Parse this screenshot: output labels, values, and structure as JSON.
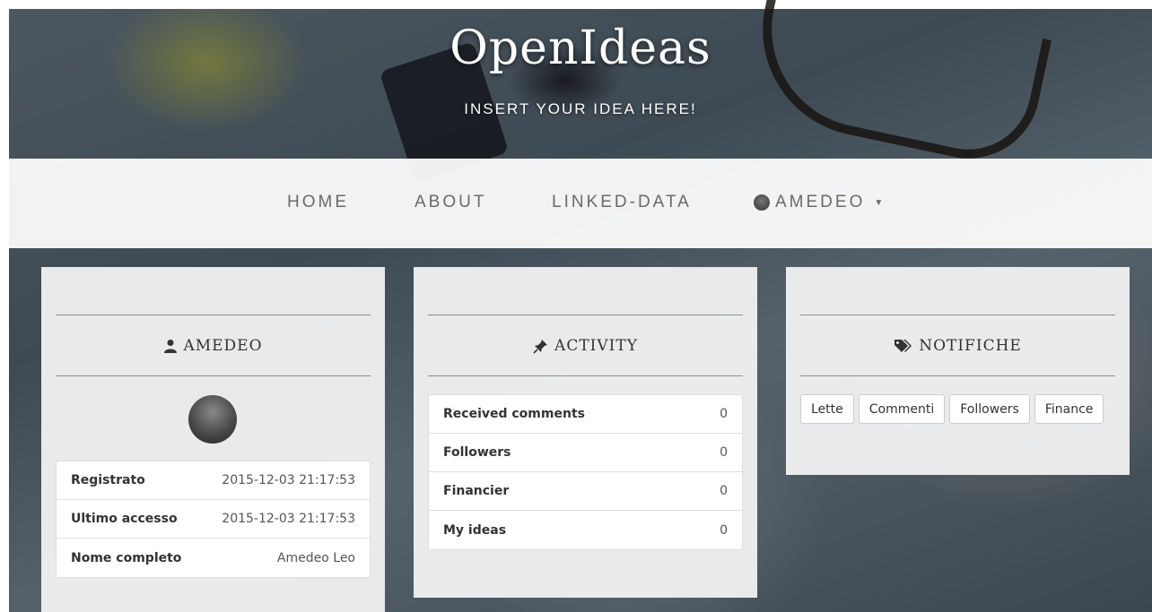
{
  "header": {
    "brand": "OpenIdeas",
    "tagline": "INSERT YOUR IDEA HERE!"
  },
  "nav": {
    "home": "HOME",
    "about": "ABOUT",
    "linked_data": "LINKED-DATA",
    "user": "AMEDEO"
  },
  "profile": {
    "title": "AMEDEO",
    "rows": [
      {
        "label": "Registrato",
        "value": "2015-12-03 21:17:53"
      },
      {
        "label": "Ultimo accesso",
        "value": "2015-12-03 21:17:53"
      },
      {
        "label": "Nome completo",
        "value": "Amedeo Leo"
      }
    ]
  },
  "activity": {
    "title": "ACTIVITY",
    "rows": [
      {
        "label": "Received comments",
        "value": "0"
      },
      {
        "label": "Followers",
        "value": "0"
      },
      {
        "label": "Financier",
        "value": "0"
      },
      {
        "label": "My ideas",
        "value": "0"
      }
    ]
  },
  "notifications": {
    "title": "NOTIFICHE",
    "buttons": [
      "Lette",
      "Commenti",
      "Followers",
      "Finance"
    ]
  },
  "icons": {
    "profile": "user-icon",
    "activity": "pushpin-icon",
    "notifications": "tags-icon"
  }
}
